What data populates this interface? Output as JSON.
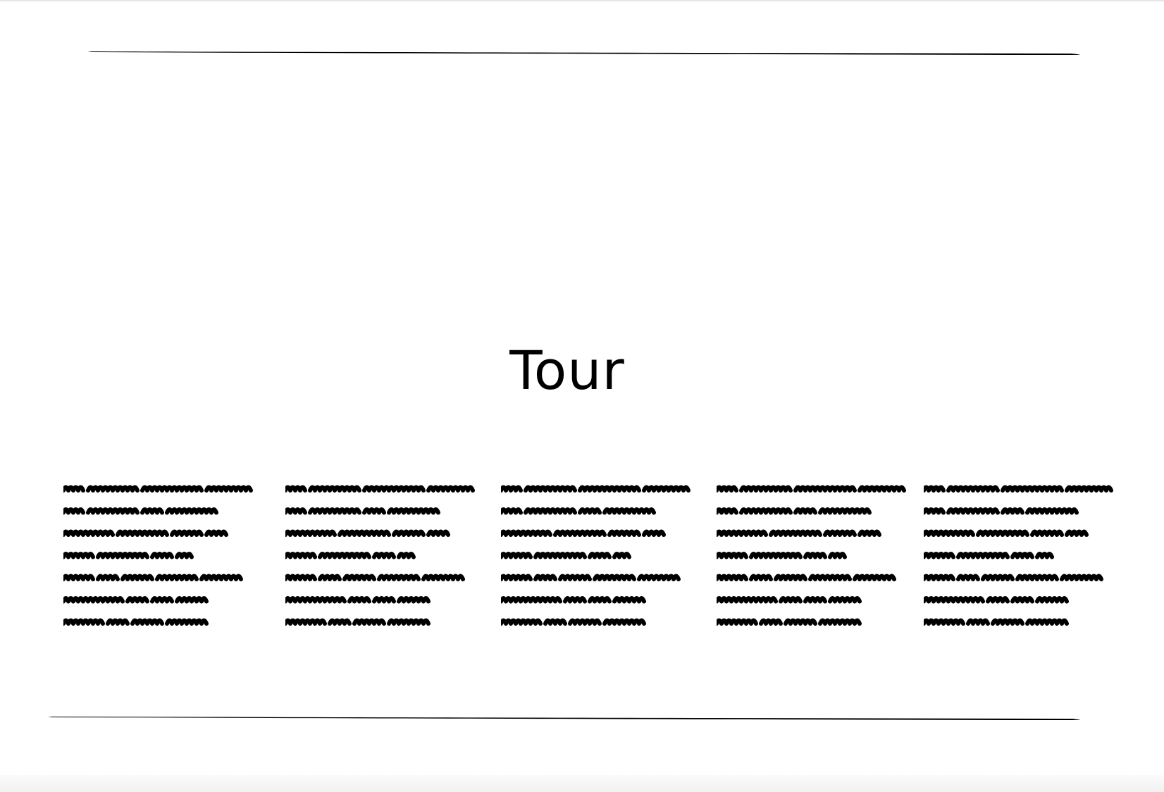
{
  "page": {
    "title": "Tour"
  },
  "text_blocks": [
    {
      "lines": [
        1,
        0.87,
        0.87,
        0.67,
        0.94,
        0.83,
        0.76
      ]
    },
    {
      "lines": [
        1,
        0.87,
        0.87,
        0.67,
        0.94,
        0.83,
        0.76
      ]
    },
    {
      "lines": [
        1,
        0.87,
        0.87,
        0.67,
        0.94,
        0.83,
        0.76
      ]
    },
    {
      "lines": [
        1,
        0.87,
        0.87,
        0.67,
        0.94,
        0.83,
        0.76
      ]
    },
    {
      "lines": [
        1,
        0.87,
        0.87,
        0.67,
        0.94,
        0.83,
        0.76
      ]
    }
  ],
  "colors": {
    "ink": "#000000",
    "background": "#ffffff"
  }
}
